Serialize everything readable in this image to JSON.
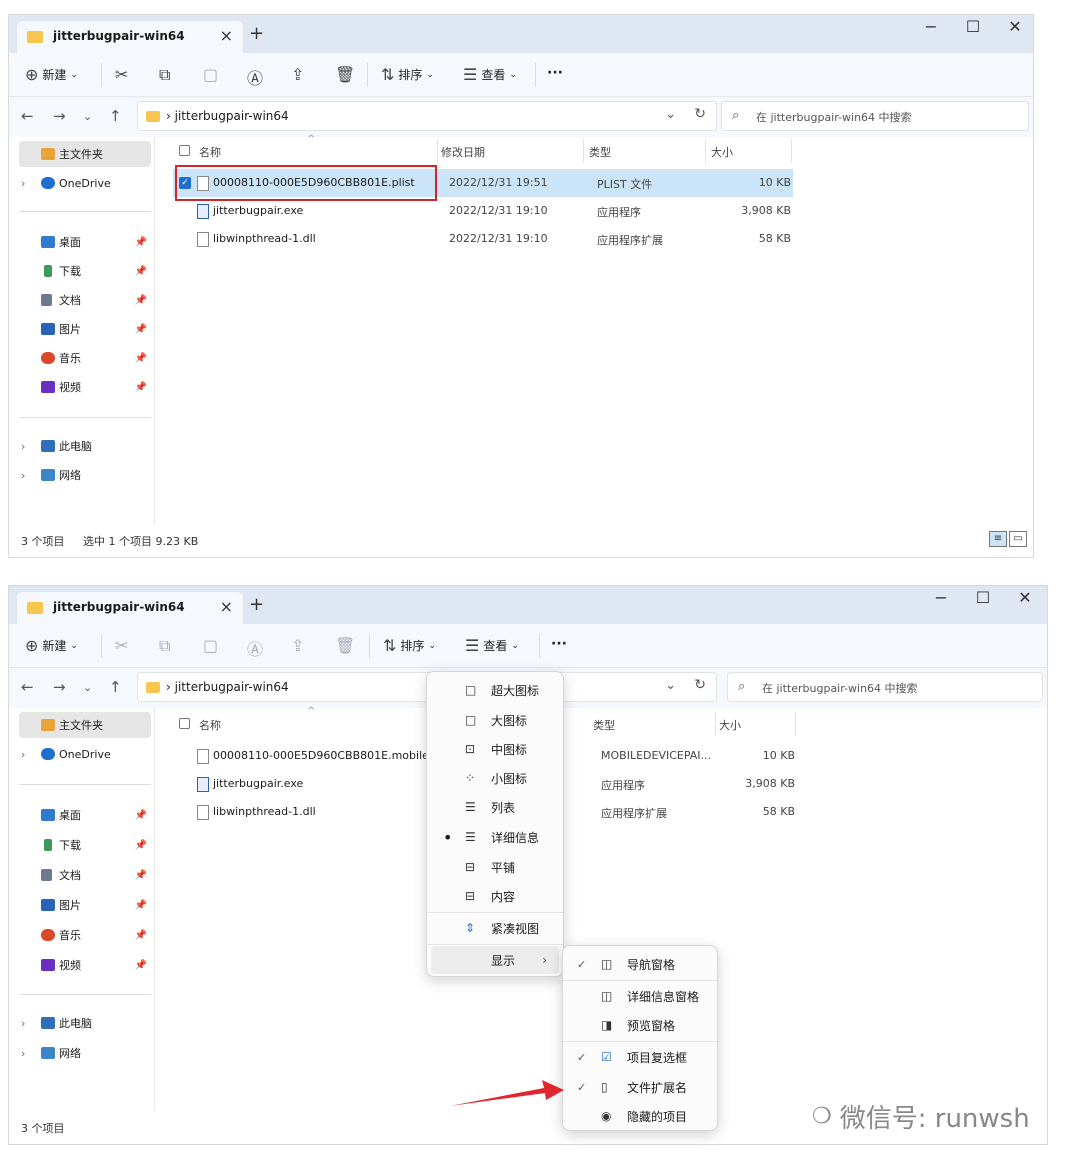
{
  "window_title": "jitterbugpair-win64",
  "toolbar": {
    "new": "新建",
    "sort": "排序",
    "view": "查看",
    "more": "···"
  },
  "address": {
    "crumb": "jitterbugpair-win64",
    "search_placeholder": "在 jitterbugpair-win64 中搜索"
  },
  "sidebar": {
    "home": "主文件夹",
    "onedrive": "OneDrive",
    "quick": [
      {
        "label": "桌面",
        "icon": "desktop-icon",
        "color": "#2f7bd0"
      },
      {
        "label": "下载",
        "icon": "download-icon",
        "color": "#3c9a5f"
      },
      {
        "label": "文档",
        "icon": "document-icon",
        "color": "#6b7a90"
      },
      {
        "label": "图片",
        "icon": "pictures-icon",
        "color": "#2a62b8"
      },
      {
        "label": "音乐",
        "icon": "music-icon",
        "color": "#d9482b"
      },
      {
        "label": "视频",
        "icon": "video-icon",
        "color": "#6a2fc0"
      }
    ],
    "this_pc": "此电脑",
    "network": "网络"
  },
  "columns": {
    "name": "名称",
    "date": "修改日期",
    "type": "类型",
    "size": "大小"
  },
  "window1": {
    "files": [
      {
        "name": "00008110-000E5D960CBB801E.plist",
        "date": "2022/12/31 19:51",
        "type": "PLIST 文件",
        "size": "10 KB",
        "selected": true
      },
      {
        "name": "jitterbugpair.exe",
        "date": "2022/12/31 19:10",
        "type": "应用程序",
        "size": "3,908 KB"
      },
      {
        "name": "libwinpthread-1.dll",
        "date": "2022/12/31 19:10",
        "type": "应用程序扩展",
        "size": "58 KB"
      }
    ],
    "status_count": "3 个项目",
    "status_selected": "选中 1 个项目  9.23 KB"
  },
  "window2": {
    "files": [
      {
        "name": "00008110-000E5D960CBB801E.mobilede...",
        "type": "MOBILEDEVICEPAI...",
        "size": "10 KB"
      },
      {
        "name": "jitterbugpair.exe",
        "type": "应用程序",
        "size": "3,908 KB"
      },
      {
        "name": "libwinpthread-1.dll",
        "type": "应用程序扩展",
        "size": "58 KB"
      }
    ],
    "status_count": "3 个项目",
    "view_menu": [
      {
        "label": "超大图标",
        "icon": "□"
      },
      {
        "label": "大图标",
        "icon": "□"
      },
      {
        "label": "中图标",
        "icon": "⊡"
      },
      {
        "label": "小图标",
        "icon": "⁘"
      },
      {
        "label": "列表",
        "icon": "☰"
      },
      {
        "label": "详细信息",
        "icon": "☰",
        "active": true
      },
      {
        "label": "平铺",
        "icon": "⊟"
      },
      {
        "label": "内容",
        "icon": "⊟"
      },
      {
        "label": "紧凑视图",
        "icon": "⇕"
      },
      {
        "label": "显示",
        "icon": "",
        "submenu": true
      }
    ],
    "show_menu": [
      {
        "label": "导航窗格",
        "checked": true
      },
      {
        "label": "详细信息窗格",
        "checked": false
      },
      {
        "label": "预览窗格",
        "checked": false
      },
      {
        "label": "项目复选框",
        "checked": true
      },
      {
        "label": "文件扩展名",
        "checked": true
      },
      {
        "label": "隐藏的项目",
        "checked": false
      }
    ]
  },
  "watermark": "微信号: runwsh",
  "colors": {
    "accent": "#1f6fd0",
    "highlight_box": "#d0262e",
    "arrow": "#e0262e",
    "selection": "#cce4f7"
  }
}
